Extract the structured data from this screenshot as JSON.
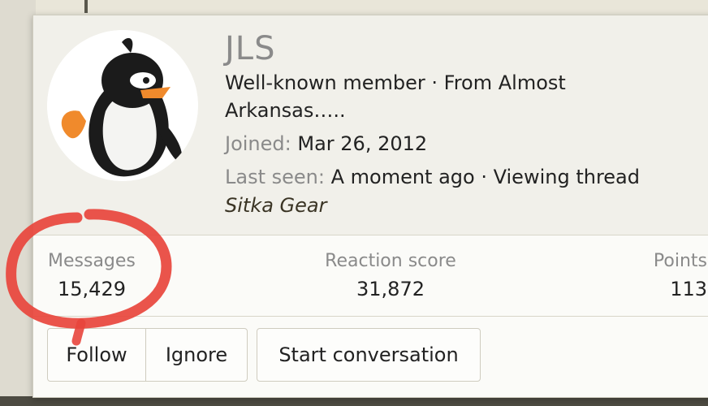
{
  "profile": {
    "username": "JLS",
    "member_title": "Well-known member",
    "separator": " · ",
    "location": "From Almost Arkansas…..",
    "joined_label": "Joined:",
    "joined_value": "Mar 26, 2012",
    "last_seen_label": "Last seen:",
    "last_seen_value": "A moment ago",
    "activity": "Viewing thread",
    "thread_title": "Sitka Gear",
    "avatar_icon": "penguin-avatar"
  },
  "stats": {
    "messages_label": "Messages",
    "messages_value": "15,429",
    "reaction_label": "Reaction score",
    "reaction_value": "31,872",
    "points_label": "Points",
    "points_value": "113"
  },
  "actions": {
    "follow": "Follow",
    "ignore": "Ignore",
    "start_conversation": "Start conversation"
  },
  "colors": {
    "annotation": "#e8453c",
    "muted_text": "#8a8a8a",
    "card_background": "#fbfbf8"
  }
}
